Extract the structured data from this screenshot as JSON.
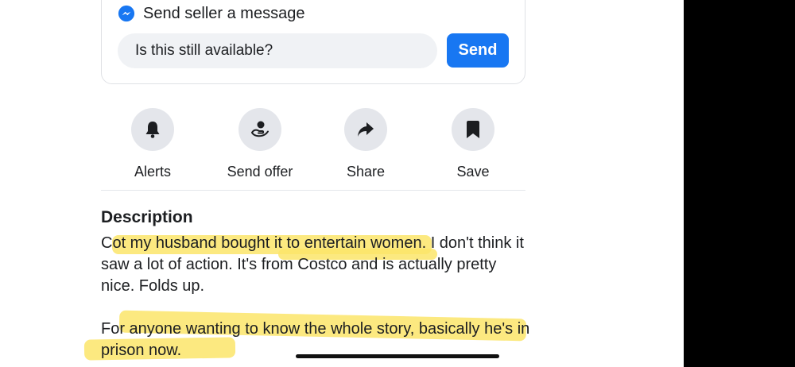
{
  "message": {
    "title": "Send seller a message",
    "input_value": "Is this still available?",
    "send_label": "Send",
    "icon": "messenger-icon"
  },
  "actions": [
    {
      "label": "Alerts",
      "icon": "bell-icon"
    },
    {
      "label": "Send offer",
      "icon": "send-offer-icon"
    },
    {
      "label": "Share",
      "icon": "share-icon"
    },
    {
      "label": "Save",
      "icon": "bookmark-icon"
    }
  ],
  "description": {
    "heading": "Description",
    "paragraph1": "Cot my husband bought it to entertain women. I don't think it saw a lot of action. It's from Costco and is actually pretty nice. Folds up.",
    "paragraph2": "For anyone wanting to know the whole story, basically he's in prison now."
  },
  "colors": {
    "accent": "#1877f2",
    "highlight": "#fbe56a"
  }
}
